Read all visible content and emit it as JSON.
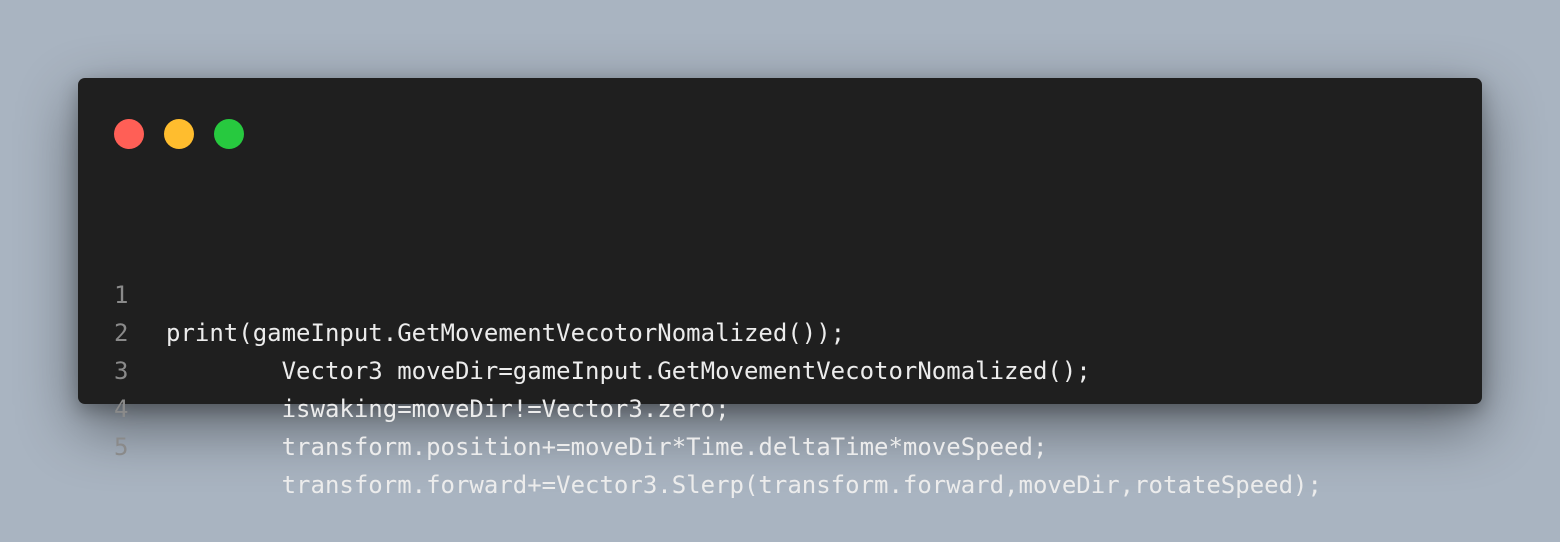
{
  "window": {
    "buttons": [
      {
        "name": "close",
        "color": "#ff5f56"
      },
      {
        "name": "minimize",
        "color": "#ffbd2e"
      },
      {
        "name": "maximize",
        "color": "#27c93f"
      }
    ]
  },
  "code": {
    "lines": [
      {
        "number": "1",
        "text": "print(gameInput.GetMovementVecotorNomalized());"
      },
      {
        "number": "2",
        "text": "        Vector3 moveDir=gameInput.GetMovementVecotorNomalized();"
      },
      {
        "number": "3",
        "text": "        iswaking=moveDir!=Vector3.zero;"
      },
      {
        "number": "4",
        "text": "        transform.position+=moveDir*Time.deltaTime*moveSpeed;"
      },
      {
        "number": "5",
        "text": "        transform.forward+=Vector3.Slerp(transform.forward,moveDir,rotateSpeed);"
      }
    ]
  }
}
